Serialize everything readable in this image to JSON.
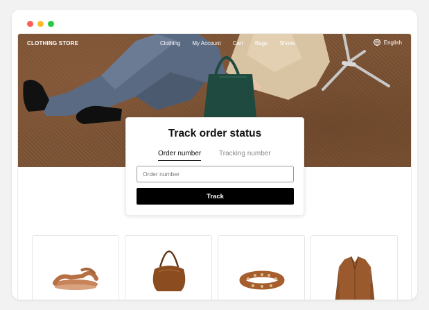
{
  "window": {
    "traffic_lights": [
      "close",
      "minimize",
      "zoom"
    ]
  },
  "nav": {
    "brand": "CLOTHING STORE",
    "links": [
      "Clothing",
      "My Account",
      "Cart",
      "Bags",
      "Shoes"
    ],
    "language": "English",
    "language_icon": "globe-icon"
  },
  "tracking": {
    "title": "Track order status",
    "tabs": [
      {
        "label": "Order number",
        "active": true
      },
      {
        "label": "Tracking number",
        "active": false
      }
    ],
    "input_placeholder": "Order number",
    "input_value": "",
    "button_label": "Track"
  },
  "products": [
    {
      "name": "sandal-product",
      "kind": "tan leather sandal"
    },
    {
      "name": "hobo-bag-product",
      "kind": "brown suede hobo bag"
    },
    {
      "name": "belt-product",
      "kind": "studded brown belt"
    },
    {
      "name": "jacket-product",
      "kind": "brown suede jacket"
    }
  ],
  "colors": {
    "button_bg": "#000000",
    "hero_floor": "#7a5234",
    "text_primary": "#111111",
    "tab_inactive": "#888888"
  }
}
